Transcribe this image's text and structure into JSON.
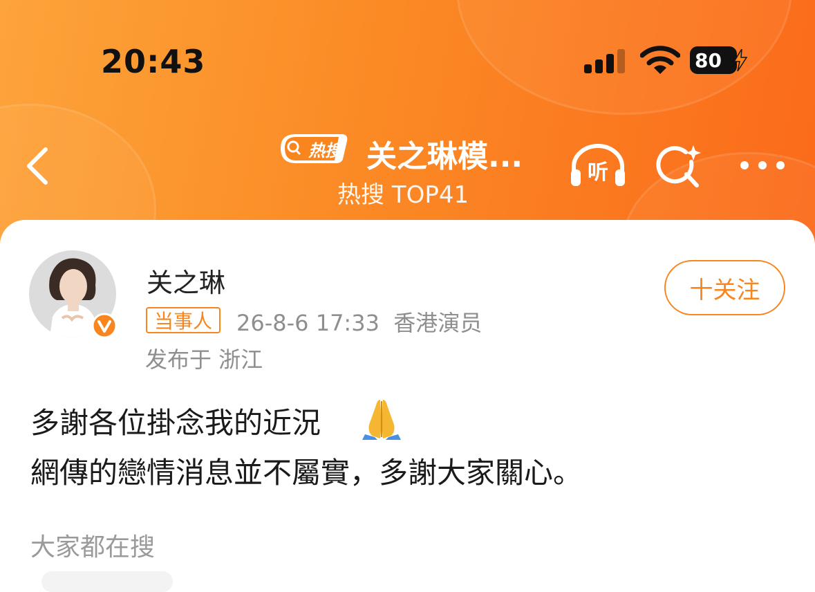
{
  "status_bar": {
    "time": "20:43",
    "battery_level": "80",
    "signal_bars": 3,
    "icons": [
      "signal-icon",
      "wifi-icon",
      "battery-icon",
      "charging-bolt-icon"
    ]
  },
  "nav": {
    "back_icon": "chevron-left-icon",
    "hot_badge": "热搜",
    "title": "关之琳模...",
    "subtitle": "热搜 TOP41",
    "listen_label": "听",
    "search_icon": "search-sparkle-icon",
    "more_icon": "more-horizontal-icon"
  },
  "post": {
    "author": {
      "name": "关之琳",
      "tag": "当事人",
      "verified_icon": "verified-v-badge-icon"
    },
    "meta": "26-8-6 17:33  香港演员",
    "location": "发布于 浙江",
    "follow_label": "十关注",
    "text_line1": "多謝各位掛念我的近況",
    "text_line2": "網傳的戀情消息並不屬實，多謝大家關心。",
    "emoji": "folded-hands-emoji"
  },
  "section": {
    "label": "大家都在搜"
  },
  "colors": {
    "header_gradient_start": "#fda43a",
    "header_gradient_end": "#fb6a1a",
    "accent": "#f8851e",
    "meta_text": "#8e8e8e"
  }
}
